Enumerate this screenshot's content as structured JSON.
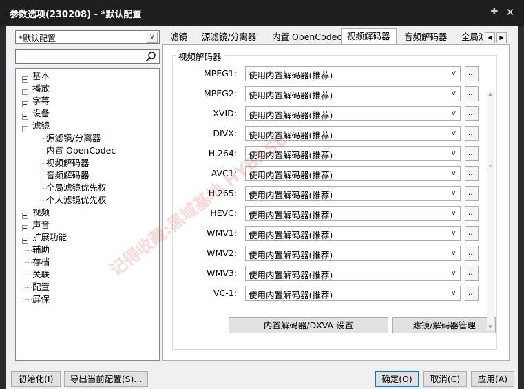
{
  "window": {
    "title": "参数选项(230208) - *默认配置"
  },
  "profile_combo": {
    "value": "*默认配置"
  },
  "search": {
    "placeholder": ""
  },
  "tree": {
    "items": [
      {
        "label": "基本",
        "expandable": true
      },
      {
        "label": "播放",
        "expandable": true
      },
      {
        "label": "字幕",
        "expandable": true
      },
      {
        "label": "设备",
        "expandable": true
      },
      {
        "label": "滤镜",
        "expandable": true,
        "expanded": true
      },
      {
        "label": "源滤镜/分离器",
        "child": true
      },
      {
        "label": "内置 OpenCodec",
        "child": true
      },
      {
        "label": "视频解码器",
        "child": true,
        "selected": true
      },
      {
        "label": "音频解码器",
        "child": true
      },
      {
        "label": "全局滤镜优先权",
        "child": true
      },
      {
        "label": "个人滤镜优先权",
        "child": true
      },
      {
        "label": "视频",
        "expandable": true
      },
      {
        "label": "声音",
        "expandable": true
      },
      {
        "label": "扩展功能",
        "expandable": true
      },
      {
        "label": "辅助"
      },
      {
        "label": "存档"
      },
      {
        "label": "关联"
      },
      {
        "label": "配置"
      },
      {
        "label": "屏保"
      }
    ]
  },
  "tabs": [
    {
      "label": "滤镜"
    },
    {
      "label": "源滤镜/分离器"
    },
    {
      "label": "内置 OpenCodec"
    },
    {
      "label": "视频解码器",
      "selected": true
    },
    {
      "label": "音频解码器"
    },
    {
      "label": "全局滤"
    }
  ],
  "group": {
    "title": "视频解码器"
  },
  "decoders": [
    {
      "name": "MPEG1:",
      "value": "使用内置解码器(推荐)"
    },
    {
      "name": "MPEG2:",
      "value": "使用内置解码器(推荐)"
    },
    {
      "name": "XVID:",
      "value": "使用内置解码器(推荐)"
    },
    {
      "name": "DIVX:",
      "value": "使用内置解码器(推荐)"
    },
    {
      "name": "H.264:",
      "value": "使用内置解码器(推荐)"
    },
    {
      "name": "AVC1:",
      "value": "使用内置解码器(推荐)"
    },
    {
      "name": "H.265:",
      "value": "使用内置解码器(推荐)"
    },
    {
      "name": "HEVC:",
      "value": "使用内置解码器(推荐)"
    },
    {
      "name": "WMV1:",
      "value": "使用内置解码器(推荐)"
    },
    {
      "name": "WMV2:",
      "value": "使用内置解码器(推荐)"
    },
    {
      "name": "WMV3:",
      "value": "使用内置解码器(推荐)"
    },
    {
      "name": "VC-1:",
      "value": "使用内置解码器(推荐)"
    }
  ],
  "dots_label": "...",
  "chevron": "v",
  "actions": {
    "dxva_settings": "内置解码器/DXVA 设置",
    "filter_manager": "滤镜/解码器管理"
  },
  "footer": {
    "init": "初始化(I)",
    "export": "导出当前配置(S)...",
    "ok": "确定(O)",
    "cancel": "取消(C)",
    "apply": "应用(A)"
  },
  "watermark": {
    "text": "记得收藏:黑域基地 HYBASE"
  },
  "colors": {
    "titlebar": "#1f1f1f",
    "dialog": "#f0f0f0",
    "focus": "#0078d7"
  }
}
